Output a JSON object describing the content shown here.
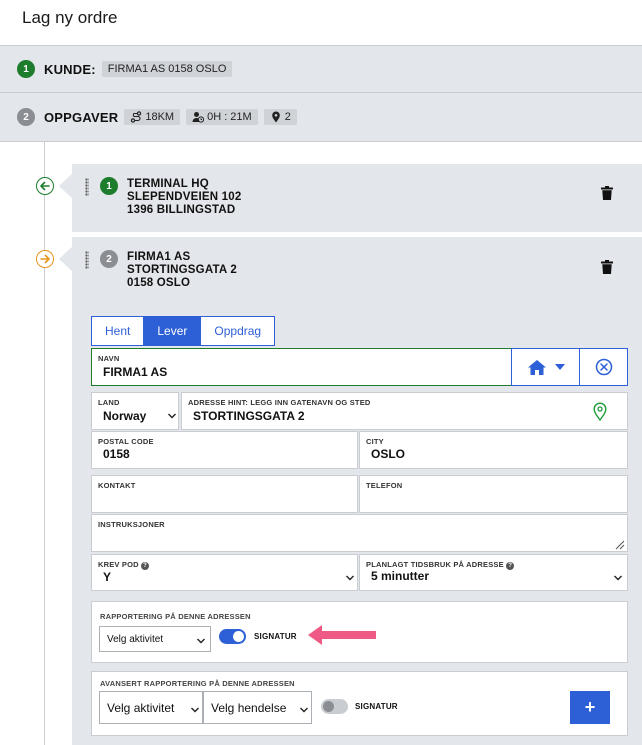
{
  "page": {
    "title": "Lag ny ordre"
  },
  "kunde": {
    "step": "1",
    "label": "KUNDE:",
    "value": "FIRMA1 AS 0158 OSLO"
  },
  "oppgaver": {
    "step": "2",
    "label": "OPPGAVER",
    "distance": "18KM",
    "duration": "0H : 21M",
    "stops_count": "2",
    "icons": {
      "distance": "route-icon",
      "duration": "driver-clock-icon",
      "stops": "map-pin-icon"
    }
  },
  "stops": [
    {
      "number": "1",
      "name": "TERMINAL HQ",
      "street": "SLEPENDVEIEN 102",
      "city": "1396 BILLINGSTAD",
      "direction_icon": "arrow-left-icon",
      "direction_color": "#1e7d2d"
    },
    {
      "number": "2",
      "name": "FIRMA1 AS",
      "street": "STORTINGSGATA 2",
      "city": "0158 OSLO",
      "direction_icon": "arrow-right-icon",
      "direction_color": "#e6951d"
    }
  ],
  "tabs": [
    {
      "label": "Hent",
      "active": false
    },
    {
      "label": "Lever",
      "active": true
    },
    {
      "label": "Oppdrag",
      "active": false
    }
  ],
  "form": {
    "navn": {
      "label": "NAVN",
      "value": "FIRMA1 AS"
    },
    "land": {
      "label": "LAND",
      "value": "Norway"
    },
    "adresse": {
      "label": "ADRESSE HINT: LEGG INN GATENAVN OG STED",
      "value": "STORTINGSGATA 2"
    },
    "postal": {
      "label": "POSTAL CODE",
      "value": "0158"
    },
    "city": {
      "label": "CITY",
      "value": "OSLO"
    },
    "kontakt": {
      "label": "KONTAKT",
      "value": ""
    },
    "telefon": {
      "label": "TELEFON",
      "value": ""
    },
    "instruksjoner": {
      "label": "INSTRUKSJONER",
      "value": ""
    },
    "krev_pod": {
      "label": "KREV POD",
      "value": "Y"
    },
    "tidsbruk": {
      "label": "PLANLAGT TIDSBRUK PÅ ADRESSE",
      "value": "5 minutter"
    }
  },
  "rapportering": {
    "title": "RAPPORTERING PÅ DENNE ADRESSEN",
    "activity_select": "Velg aktivitet",
    "toggle_label": "SIGNATUR",
    "toggle_on": true
  },
  "avansert": {
    "title": "AVANSERT RAPPORTERING PÅ DENNE ADRESSEN",
    "activity_select": "Velg aktivitet",
    "event_select": "Velg hendelse",
    "toggle_label": "SIGNATUR",
    "toggle_on": false,
    "add_label": "+"
  },
  "colors": {
    "accent": "#2d5fd6",
    "success": "#1e7d2d",
    "annotation_arrow": "#ee5a84"
  }
}
